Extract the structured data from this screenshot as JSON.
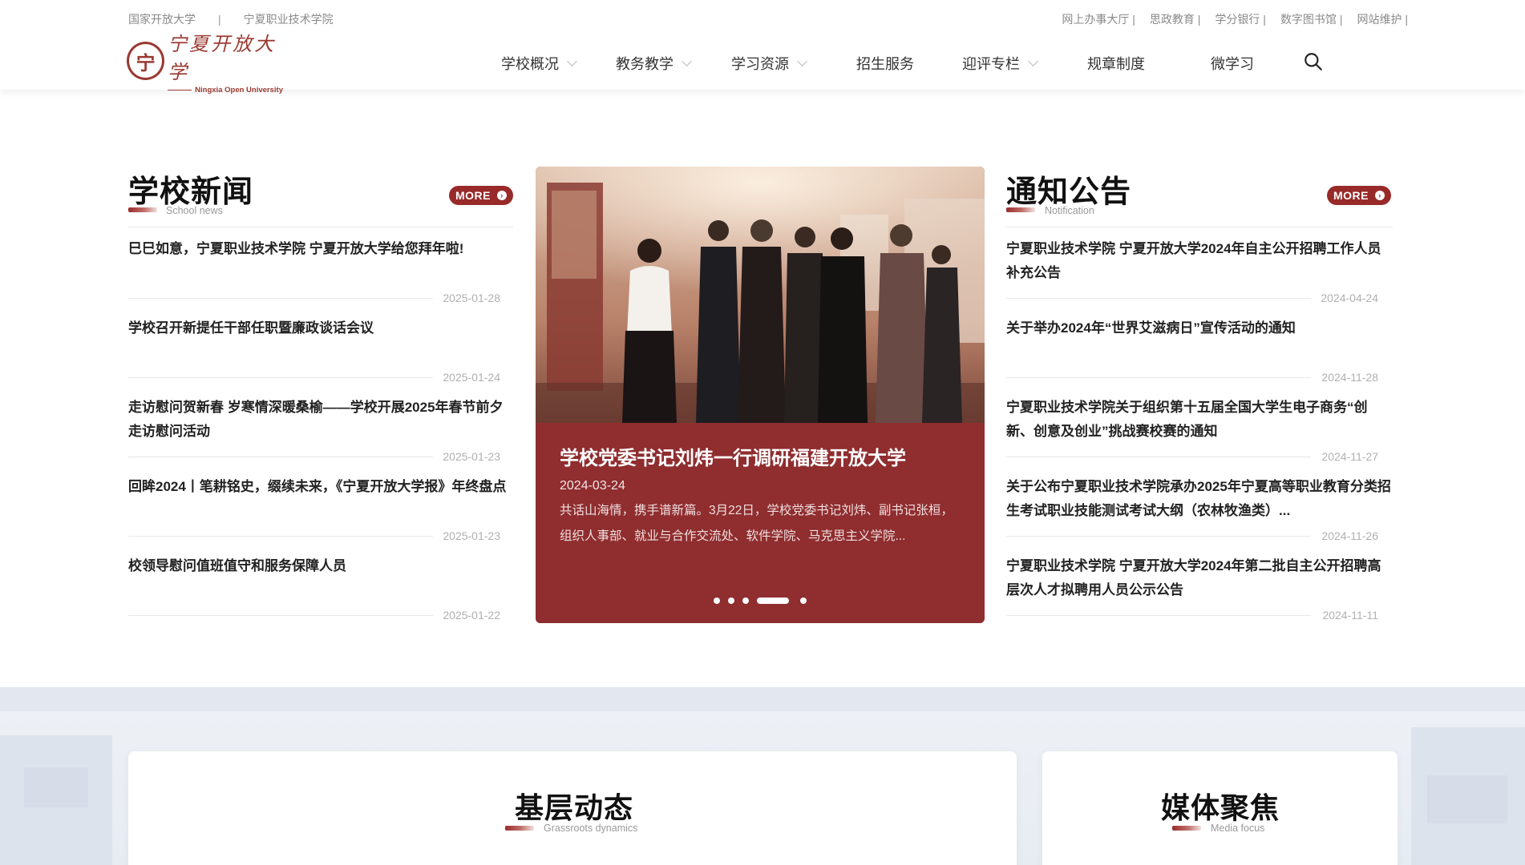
{
  "top_links_left": [
    "国家开放大学",
    "宁夏职业技术学院"
  ],
  "top_links_right": [
    "网上办事大厅 |",
    "思政教育 |",
    "学分银行 |",
    "数字图书馆 |",
    "网站维护 |"
  ],
  "logo": {
    "cn": "宁夏开放大学",
    "en": "Ningxia Open University"
  },
  "nav": [
    {
      "label": "学校概况"
    },
    {
      "label": "教务教学"
    },
    {
      "label": "学习资源"
    },
    {
      "label": "招生服务"
    },
    {
      "label": "迎评专栏"
    },
    {
      "label": "规章制度"
    },
    {
      "label": "微学习"
    }
  ],
  "school_news": {
    "title": "学校新闻",
    "subtitle": "School news",
    "more": "MORE",
    "items": [
      {
        "title": "巳巳如意，宁夏职业技术学院 宁夏开放大学给您拜年啦!",
        "date": "2025-01-28"
      },
      {
        "title": "学校召开新提任干部任职暨廉政谈话会议",
        "date": "2025-01-24"
      },
      {
        "title": "走访慰问贺新春 岁寒情深暖桑榆——学校开展2025年春节前夕走访慰问活动",
        "date": "2025-01-23"
      },
      {
        "title": "回眸2024丨笔耕铭史，缀续未来，《宁夏开放大学报》年终盘点",
        "date": "2025-01-23"
      },
      {
        "title": "校领导慰问值班值守和服务保障人员",
        "date": "2025-01-22"
      }
    ]
  },
  "slider": {
    "title": "学校党委书记刘炜一行调研福建开放大学",
    "date": "2024-03-24",
    "desc": "共话山海情，携手谱新篇。3月22日，学校党委书记刘炜、副书记张桓，组织人事部、就业与合作交流处、软件学院、马克思主义学院..."
  },
  "notices": {
    "title": "通知公告",
    "subtitle": "Notification",
    "more": "MORE",
    "items": [
      {
        "title": "宁夏职业技术学院 宁夏开放大学2024年自主公开招聘工作人员补充公告",
        "date": "2024-04-24"
      },
      {
        "title": "关于举办2024年“世界艾滋病日”宣传活动的通知",
        "date": "2024-11-28"
      },
      {
        "title": "宁夏职业技术学院关于组织第十五届全国大学生电子商务“创新、创意及创业”挑战赛校赛的通知",
        "date": "2024-11-27"
      },
      {
        "title": "关于公布宁夏职业技术学院承办2025年宁夏高等职业教育分类招生考试职业技能测试考试大纲（农林牧渔类）...",
        "date": "2024-11-26"
      },
      {
        "title": "宁夏职业技术学院 宁夏开放大学2024年第二批自主公开招聘高层次人才拟聘用人员公示公告",
        "date": "2024-11-11"
      }
    ]
  },
  "grassroots": {
    "title": "基层动态",
    "subtitle": "Grassroots dynamics"
  },
  "media": {
    "title": "媒体聚焦",
    "subtitle": "Media focus"
  }
}
